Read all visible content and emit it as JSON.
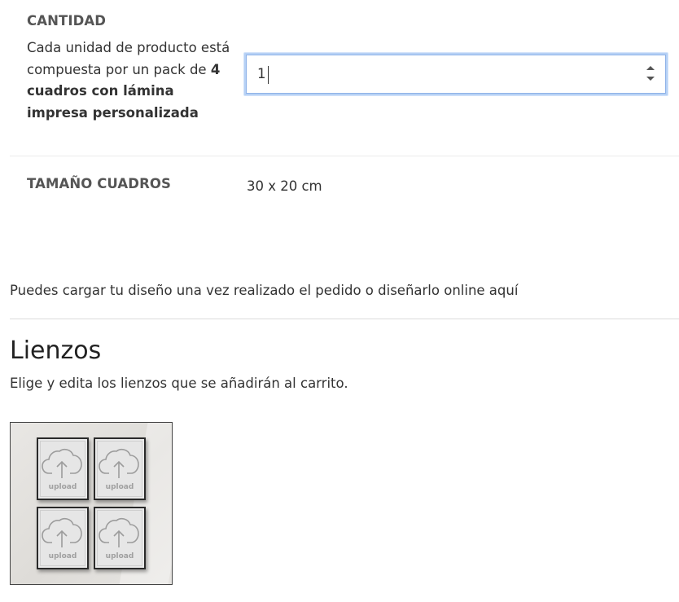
{
  "quantity": {
    "label": "CANTIDAD",
    "desc_prefix": "Cada unidad de producto está compuesta por un pack de ",
    "desc_bold": "4 cuadros con lámina impresa personalizada",
    "value": "1"
  },
  "size": {
    "label": "TAMAÑO CUADROS",
    "value": "30 x 20 cm"
  },
  "upload_info": "Puedes cargar tu diseño una vez realizado el pedido o diseñarlo online aquí",
  "lienzos": {
    "title": "Lienzos",
    "subtitle": "Elige y edita los lienzos que se añadirán al carrito.",
    "frames": [
      {
        "label": "upload",
        "icon": "cloud-upload-icon"
      },
      {
        "label": "upload",
        "icon": "cloud-upload-icon"
      },
      {
        "label": "upload",
        "icon": "cloud-upload-icon"
      },
      {
        "label": "upload",
        "icon": "cloud-upload-icon"
      }
    ]
  },
  "colors": {
    "focus_border": "#b6d1f5",
    "text": "#333333",
    "label": "#555555"
  }
}
